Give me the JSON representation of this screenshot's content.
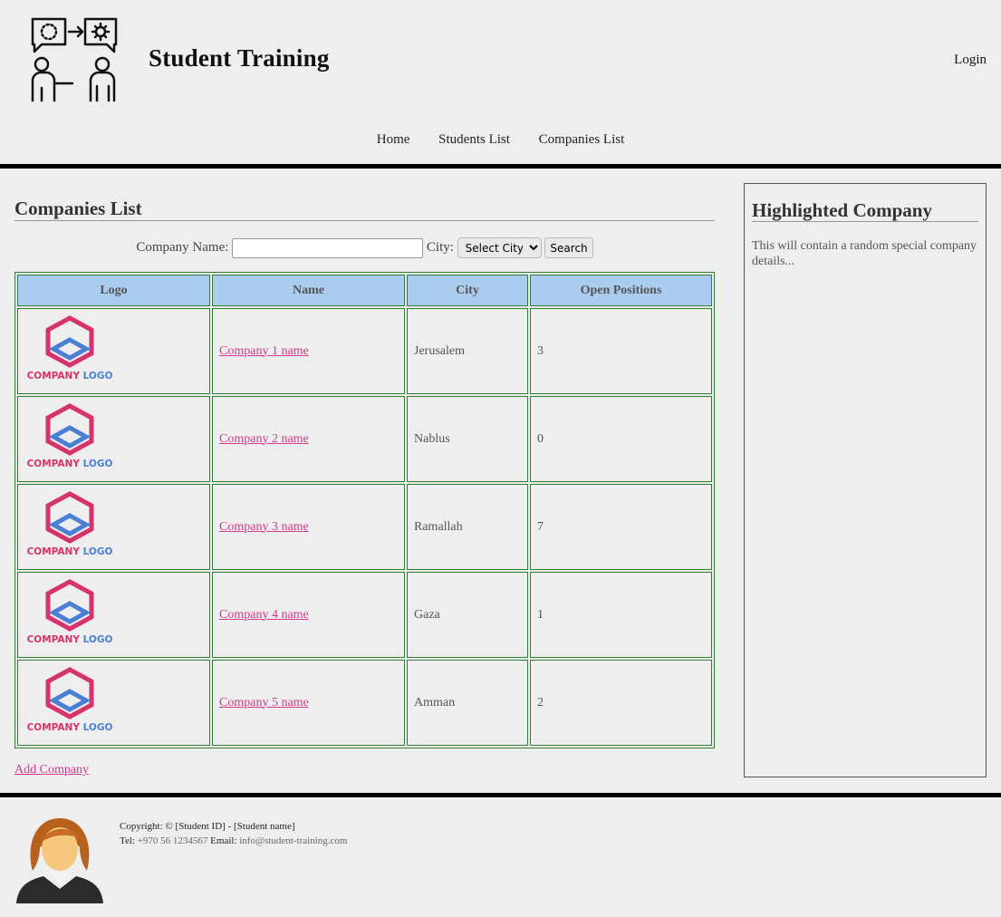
{
  "header": {
    "site_title": "Student Training",
    "login_label": "Login",
    "nav": [
      "Home",
      "Students List",
      "Companies List"
    ]
  },
  "main": {
    "title": "Companies List",
    "search": {
      "name_label": "Company Name:",
      "name_value": "",
      "city_label": "City:",
      "city_selected": "Select City",
      "search_label": "Search"
    },
    "table": {
      "headers": [
        "Logo",
        "Name",
        "City",
        "Open Positions"
      ],
      "rows": [
        {
          "logo_text": "COMPANY LOGO",
          "name": "Company 1 name",
          "city": "Jerusalem",
          "positions": "3"
        },
        {
          "logo_text": "COMPANY LOGO",
          "name": "Company 2 name",
          "city": "Nablus",
          "positions": "0"
        },
        {
          "logo_text": "COMPANY LOGO",
          "name": "Company 3 name",
          "city": "Ramallah",
          "positions": "7"
        },
        {
          "logo_text": "COMPANY LOGO",
          "name": "Company 4 name",
          "city": "Gaza",
          "positions": "1"
        },
        {
          "logo_text": "COMPANY LOGO",
          "name": "Company 5 name",
          "city": "Amman",
          "positions": "2"
        }
      ]
    },
    "add_label": "Add Company"
  },
  "sidebar": {
    "title": "Highlighted Company",
    "text": "This will contain a random special company details..."
  },
  "footer": {
    "copyright": "Copyright: © [Student ID] - [Student name]",
    "tel_label": "Tel:",
    "tel_value": "+970 56 1234567",
    "email_label": "Email:",
    "email_value": "info@student-training.com"
  },
  "colors": {
    "accent_link": "#d03b8c",
    "table_header": "#aaccee",
    "table_border": "#2e7d32",
    "logo_pink": "#d6336c",
    "logo_blue": "#4a7fd4"
  },
  "icons": [
    "training-logo-icon",
    "company-logo-icon",
    "user-avatar-icon",
    "chevron-down-icon"
  ]
}
